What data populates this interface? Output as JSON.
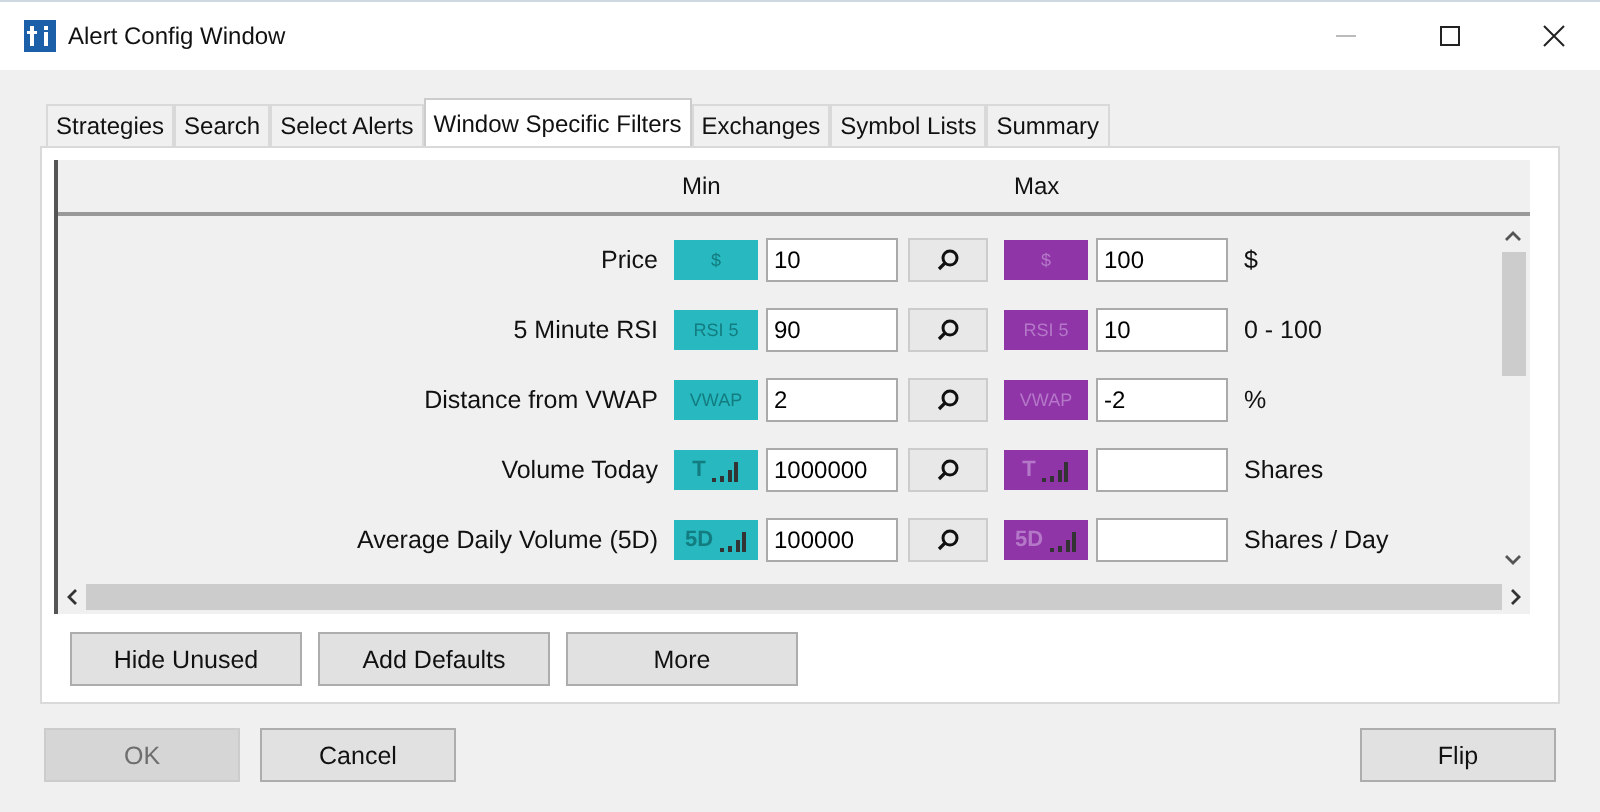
{
  "window": {
    "title": "Alert Config Window"
  },
  "tabs": [
    {
      "label": "Strategies",
      "selected": false
    },
    {
      "label": "Search",
      "selected": false
    },
    {
      "label": "Select Alerts",
      "selected": false
    },
    {
      "label": "Window Specific Filters",
      "selected": true
    },
    {
      "label": "Exchanges",
      "selected": false
    },
    {
      "label": "Symbol Lists",
      "selected": false
    },
    {
      "label": "Summary",
      "selected": false
    }
  ],
  "columns": {
    "min": "Min",
    "max": "Max"
  },
  "filters": [
    {
      "name": "Price",
      "min": {
        "icon": {
          "kind": "text",
          "text": "$"
        },
        "value": "10"
      },
      "max": {
        "icon": {
          "kind": "text",
          "text": "$"
        },
        "value": "100"
      },
      "unit": "$"
    },
    {
      "name": "5 Minute RSI",
      "min": {
        "icon": {
          "kind": "text",
          "text": "RSI 5"
        },
        "value": "90"
      },
      "max": {
        "icon": {
          "kind": "text",
          "text": "RSI 5"
        },
        "value": "10"
      },
      "unit": "0 - 100"
    },
    {
      "name": "Distance from VWAP",
      "min": {
        "icon": {
          "kind": "text",
          "text": "VWAP"
        },
        "value": "2"
      },
      "max": {
        "icon": {
          "kind": "text",
          "text": "VWAP"
        },
        "value": "-2"
      },
      "unit": "%"
    },
    {
      "name": "Volume Today",
      "min": {
        "icon": {
          "kind": "bars",
          "text": "T"
        },
        "value": "1000000"
      },
      "max": {
        "icon": {
          "kind": "bars",
          "text": "T"
        }
      },
      "unit": "Shares"
    },
    {
      "name": "Average Daily Volume (5D)",
      "min": {
        "icon": {
          "kind": "bars",
          "text": "5D"
        },
        "value": "100000"
      },
      "max": {
        "icon": {
          "kind": "bars",
          "text": "5D"
        }
      },
      "unit": "Shares / Day"
    }
  ],
  "panel_buttons": [
    "Hide Unused",
    "Add Defaults",
    "More"
  ],
  "dialog_buttons": [
    {
      "label": "OK",
      "disabled": true
    },
    {
      "label": "Cancel",
      "disabled": false
    },
    {
      "label": "Flip",
      "disabled": false
    }
  ]
}
